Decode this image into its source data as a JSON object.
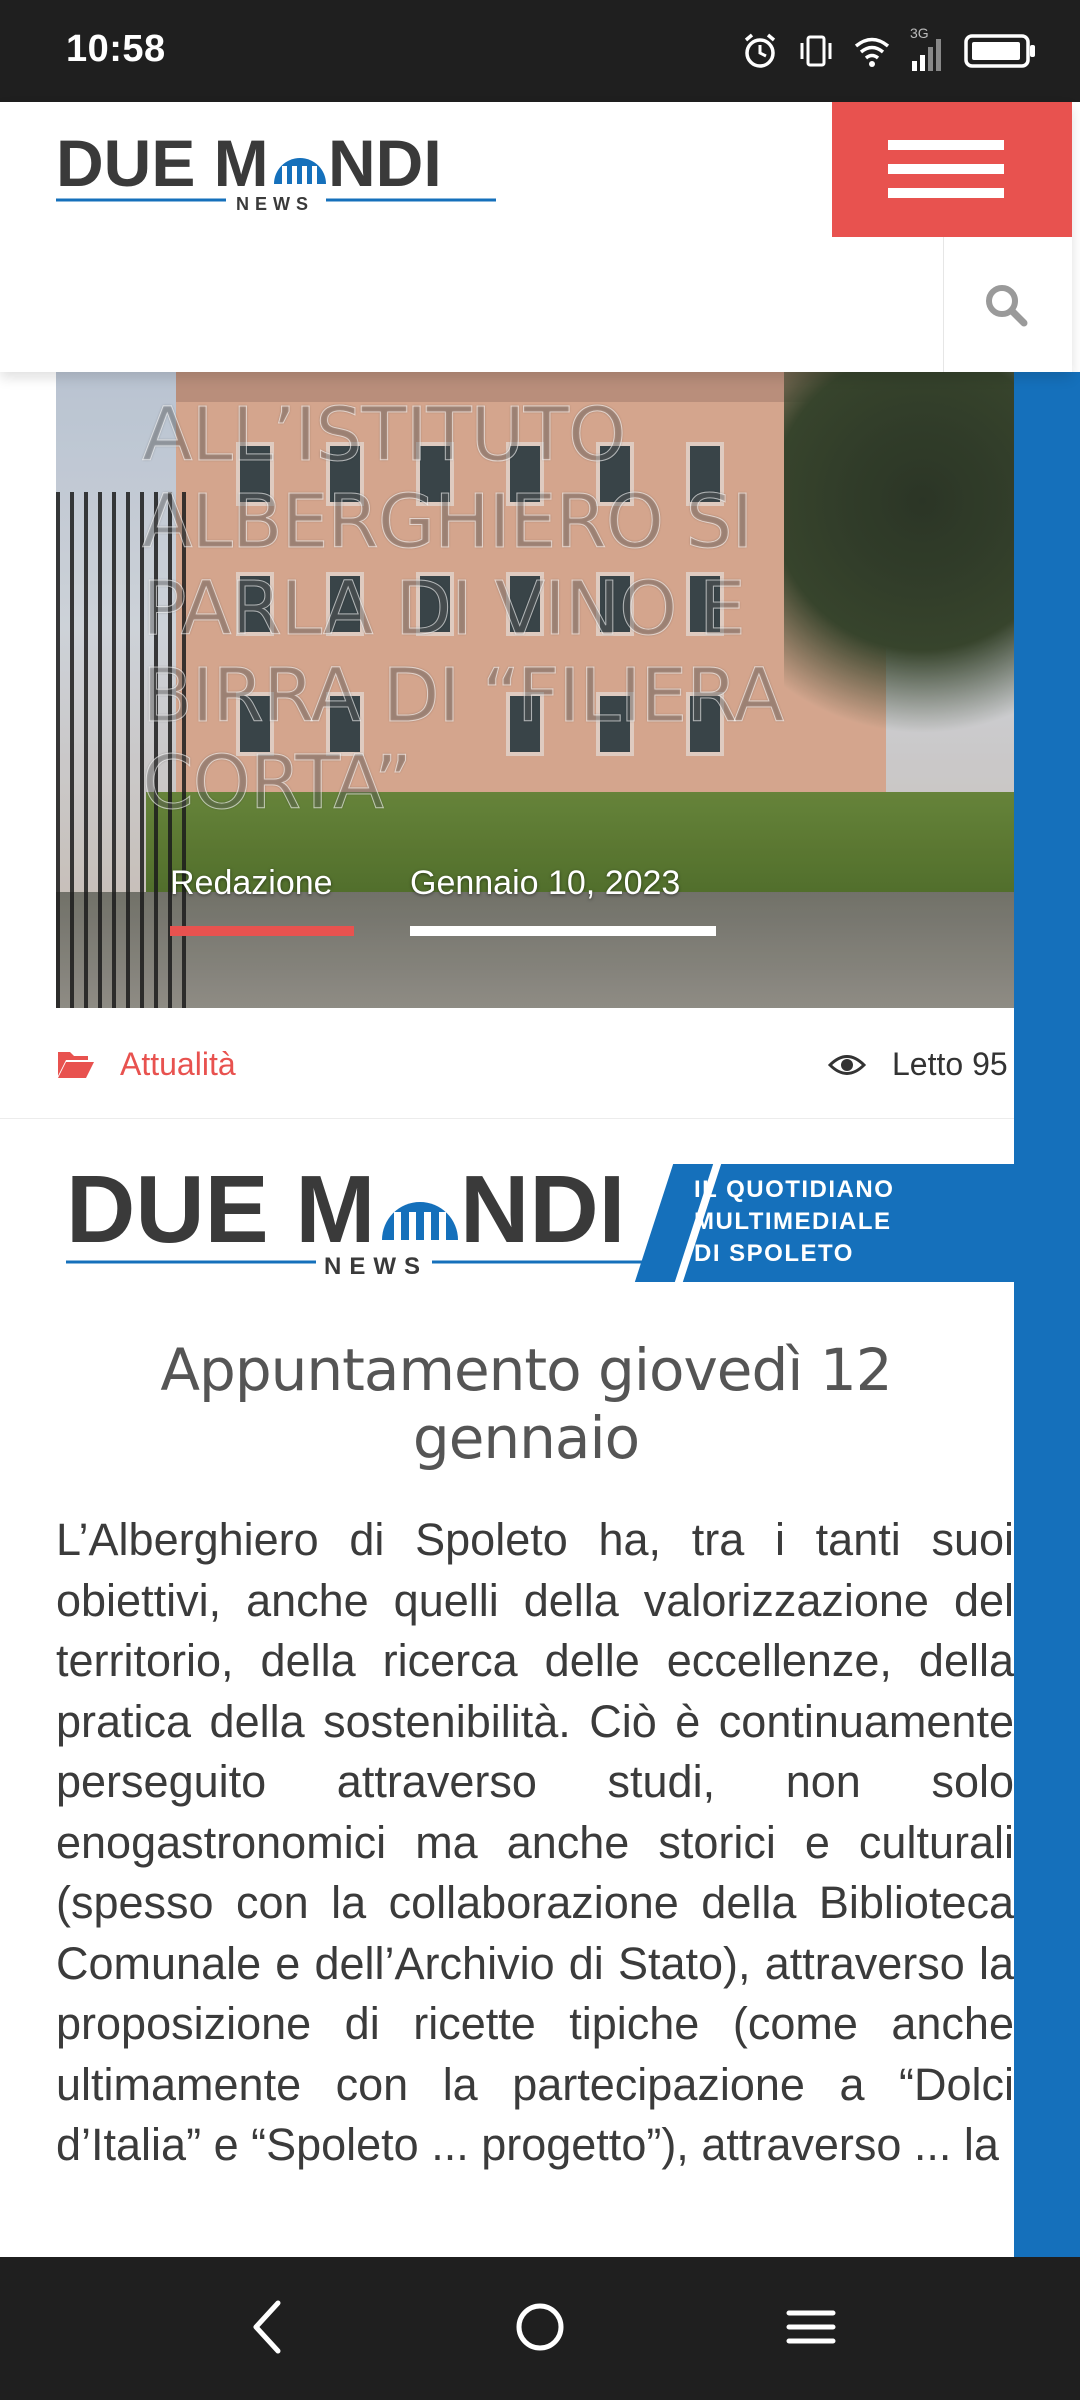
{
  "status_bar": {
    "time": "10:58",
    "network_label": "3G",
    "icons": [
      "alarm-icon",
      "vibrate-icon",
      "wifi-icon",
      "signal-icon",
      "battery-icon"
    ]
  },
  "header": {
    "logo": {
      "wordmark": "DUE MONDI",
      "sub": "NEWS"
    },
    "menu_icon": "hamburger-icon",
    "search_icon": "search-icon"
  },
  "article": {
    "title": "ALL’ISTITUTO ALBERGHIERO SI PARLA DI VINO E BIRRA DI “FILIERA CORTA”",
    "author": "Redazione",
    "date": "Gennaio 10, 2023",
    "category": "Attualità",
    "views": "Letto 95",
    "subtitle": "Appuntamento giovedì 12 gennaio",
    "body": "L’Alberghiero di Spoleto ha, tra i tanti suoi obiettivi, anche quelli della valorizzazione del territorio, della ricerca delle eccellenze, della pratica della sostenibilità. Ciò è continuamente perseguito attraverso studi, non solo enogastronomici ma anche storici e culturali (spesso con la collaborazione della Biblioteca Comunale e dell’Archivio di Stato), attraverso la proposizione di ricette tipiche (come anche ultimamente con la partecipazione a “Dolci d’Italia” e “Spoleto ... progetto”), attraverso ... la"
  },
  "banner": {
    "wordmark": "DUE MONDI",
    "sub": "NEWS",
    "tagline": [
      "IL QUOTIDIANO",
      "MULTIMEDIALE",
      "DI SPOLETO"
    ]
  },
  "colors": {
    "accent_red": "#e8524f",
    "brand_blue": "#1570bb",
    "logo_dark": "#3a3a3a"
  }
}
